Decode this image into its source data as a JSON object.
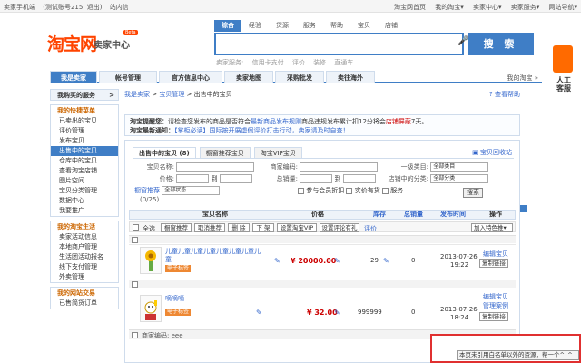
{
  "topbar": {
    "left": [
      "卖家手机端",
      "(测试账号215, 退出)",
      "站内信"
    ],
    "right": [
      "淘宝网首页",
      "我的淘宝▾",
      "卖家中心▾",
      "卖家服务▾",
      "网站导航▾"
    ]
  },
  "logo": {
    "text": "淘宝网",
    "sub": "卖家中心",
    "beta": "Beta"
  },
  "search": {
    "tabs": [
      "综合",
      "经验",
      "货源",
      "服务",
      "帮助",
      "宝贝",
      "店铺"
    ],
    "button": "搜 索",
    "hot": [
      "卖家服务:",
      "信用卡支付",
      "评价",
      "装修",
      "直通车"
    ]
  },
  "nav": {
    "items": [
      "我是卖家",
      "帐号管理",
      "官方信息中心",
      "卖家地图",
      "采购批发",
      "卖往海外"
    ],
    "right": "我的淘宝 »"
  },
  "sidebar": {
    "service": "我购买的服务",
    "groups": [
      {
        "title": "我的快捷菜单",
        "items": [
          "已卖出的宝贝",
          "评价管理",
          "发布宝贝",
          "出售中的宝贝",
          "仓库中的宝贝",
          "查看淘宝店铺",
          "图片空间",
          "宝贝分类管理",
          "数据中心",
          "我要推广"
        ]
      },
      {
        "title": "我的淘宝生活",
        "items": [
          "卖家活动信息",
          "本地商户管理",
          "生活团活动报名",
          "线下支付管理",
          "外卖管理"
        ]
      },
      {
        "title": "我的网站交易",
        "items": [
          "已售简货订单"
        ]
      }
    ]
  },
  "main": {
    "breadcrumb": [
      "我是卖家",
      "宝贝管理",
      "出售中的宝贝"
    ],
    "help": "查看帮助",
    "notice1_label": "淘宝提醒您：",
    "notice1_text": "请检查您发布的商品是否符合",
    "notice1_link": "最新商品发布规则",
    "notice1_tail": "商品违规发布累计扣12分将会",
    "notice1_red": "店铺屏蔽",
    "notice1_end": "7天。",
    "notice2_label": "淘宝最新通知：",
    "notice2_text": "【掌柜必读】国际按开展虚假评价打击行动，卖家请及时自查！",
    "tabs": [
      "出售中的宝贝 (8)",
      "橱窗推荐宝贝",
      "淘宝VIP宝贝"
    ],
    "collect": "宝贝回收站",
    "form": {
      "name": "宝贝名称:",
      "code": "商家编码:",
      "cat1": "一级类目:",
      "cat1_val": "全部类目",
      "price": "价格:",
      "to": "到",
      "sales": "总销量:",
      "shopcat": "店铺中的分类:",
      "shopcat_val": "全部分类",
      "window": "橱窗推荐",
      "window_count": "(0/25)",
      "window_val": "全部状态",
      "chk1": "参与会员折扣",
      "chk2": "实价有货",
      "chk3": "服务",
      "search": "搜索"
    },
    "thead": [
      "宝贝名称",
      "价格",
      "库存",
      "总销量",
      "发布时间",
      "操作"
    ],
    "actions": {
      "all": "全选",
      "btns": [
        "橱窗推荐",
        "取消推荐",
        "删 除",
        "下 架",
        "设置淘宝VIP",
        "设置评论有礼",
        "评价"
      ],
      "select": "加入特色推▾"
    },
    "rows": [
      {
        "title": "儿童儿童儿童儿童儿童儿童儿童儿童",
        "tag": "电子标签",
        "price": "¥ 20000.00",
        "stock": "29",
        "sales": "0",
        "date": "2013-07-26",
        "time": "19:22",
        "edit": "编辑宝贝",
        "copy": "复制链接"
      },
      {
        "title": "嘀嘀嘀",
        "tag": "电子标签",
        "price": "¥ 32.00",
        "stock": "999999",
        "sales": "0",
        "date": "2013-07-26",
        "time": "18:24",
        "edit": "编辑宝贝",
        "edit2": "管理案例",
        "copy": "复制链接"
      }
    ],
    "sep3": "商家编码: eee"
  },
  "rightbar": {
    "text": "人工客服"
  },
  "toast": {
    "text": "本页未引用白名单以外的资源，帮一个^_^"
  }
}
